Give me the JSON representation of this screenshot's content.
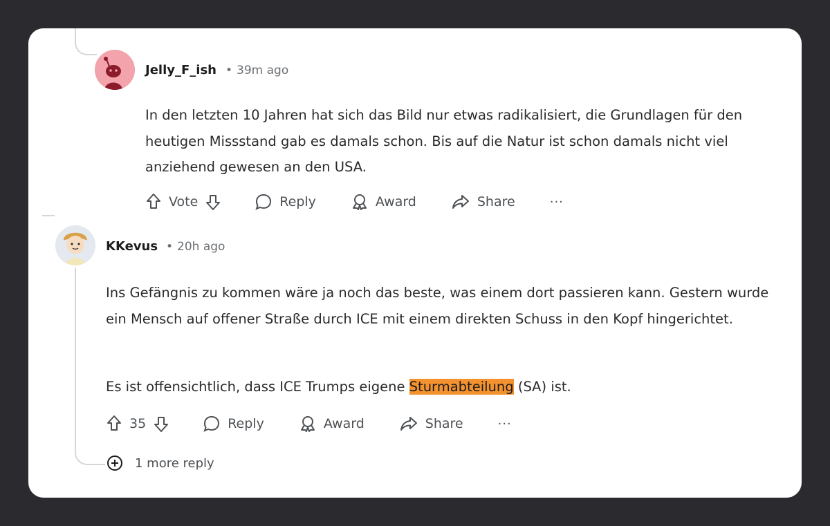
{
  "comments": [
    {
      "author": "Jelly_F_ish",
      "separator": "•",
      "time": "39m ago",
      "paragraphs": [
        "In den letzten 10 Jahren hat sich das Bild nur etwas radikalisiert, die Grundlagen für den heutigen Missstand gab es damals schon. Bis auf die Natur ist schon damals nicht viel anziehend gewesen an den USA."
      ],
      "vote_label": "Vote",
      "reply_label": "Reply",
      "award_label": "Award",
      "share_label": "Share",
      "more_label": "···"
    },
    {
      "author": "KKevus",
      "separator": "•",
      "time": "20h ago",
      "paragraph1": "Ins Gefängnis zu kommen wäre ja noch das beste, was einem dort passieren kann. Gestern wurde ein Mensch auf offener Straße durch ICE mit einem direkten Schuss in den Kopf hingerichtet.",
      "paragraph2_before": "Es ist offensichtlich, dass ICE Trumps eigene ",
      "paragraph2_highlight": "Sturmabteilung",
      "paragraph2_after": " (SA) ist.",
      "vote_count": "35",
      "reply_label": "Reply",
      "award_label": "Award",
      "share_label": "Share",
      "more_label": "···"
    }
  ],
  "more_replies_label": "1 more reply",
  "colors": {
    "page_background": "#2b2b2f",
    "card_background": "#ffffff",
    "highlight": "#f4922f",
    "thread_line": "#d4d7da",
    "avatar1_bg": "#f2a3ab"
  },
  "icons": [
    "upvote-icon",
    "downvote-icon",
    "reply-bubble-icon",
    "award-icon",
    "share-arrow-icon",
    "plus-circle-icon"
  ]
}
